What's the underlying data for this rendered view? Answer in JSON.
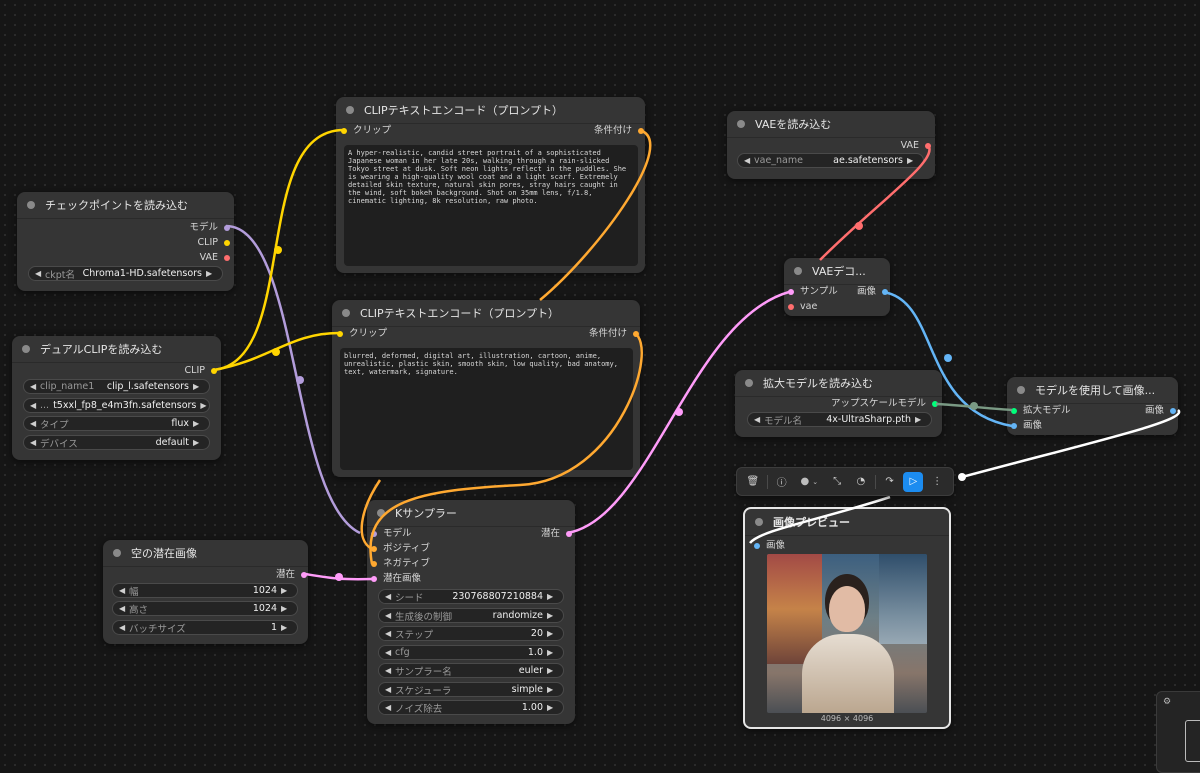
{
  "colors": {
    "model": "#b39ddb",
    "clip": "#ffd500",
    "vae": "#ff6e6e",
    "conditioning": "#ffa931",
    "latent": "#ff9cf9",
    "image": "#64b5f6",
    "upscale_model": "#00ff7b",
    "widget_bg": "#242424",
    "node_bg": "#353535",
    "run_button": "#1c8cf0"
  },
  "nodes": {
    "checkpoint": {
      "title": "チェックポイントを読み込む",
      "outputs": [
        "モデル",
        "CLIP",
        "VAE"
      ],
      "widget": {
        "label": "ckpt名",
        "value": "Chroma1-HD.safetensors"
      }
    },
    "dual_clip": {
      "title": "デュアルCLIPを読み込む",
      "output": "CLIP",
      "widgets": [
        {
          "label": "clip_name1",
          "value": "clip_l.safetensors"
        },
        {
          "label": "...",
          "value": "t5xxl_fp8_e4m3fn.safetensors"
        },
        {
          "label": "タイプ",
          "value": "flux"
        },
        {
          "label": "デバイス",
          "value": "default"
        }
      ]
    },
    "clip_pos": {
      "title": "CLIPテキストエンコード（プロンプト）",
      "input": "クリップ",
      "output": "条件付け",
      "text": "A hyper-realistic, candid street portrait of a sophisticated Japanese woman in her late 20s, walking through a rain-slicked Tokyo street at dusk. Soft neon lights reflect in the puddles. She is wearing a high-quality wool coat and a light scarf. Extremely detailed skin texture, natural skin pores, stray hairs caught in the wind, soft bokeh background. Shot on 35mm lens, f/1.8, cinematic lighting, 8k resolution, raw photo."
    },
    "clip_neg": {
      "title": "CLIPテキストエンコード（プロンプト）",
      "input": "クリップ",
      "output": "条件付け",
      "text": "blurred, deformed, digital art, illustration, cartoon, anime, unrealistic, plastic skin, smooth skin, low quality, bad anatomy, text, watermark, signature."
    },
    "empty_latent": {
      "title": "空の潜在画像",
      "output": "潜在",
      "widgets": [
        {
          "label": "幅",
          "value": "1024"
        },
        {
          "label": "高さ",
          "value": "1024"
        },
        {
          "label": "バッチサイズ",
          "value": "1"
        }
      ]
    },
    "ksampler": {
      "title": "Kサンプラー",
      "inputs": [
        "モデル",
        "ポジティブ",
        "ネガティブ",
        "潜在画像"
      ],
      "output": "潜在",
      "widgets": [
        {
          "label": "シード",
          "value": "230768807210884"
        },
        {
          "label": "生成後の制御",
          "value": "randomize"
        },
        {
          "label": "ステップ",
          "value": "20"
        },
        {
          "label": "cfg",
          "value": "1.0"
        },
        {
          "label": "サンプラー名",
          "value": "euler"
        },
        {
          "label": "スケジューラ",
          "value": "simple"
        },
        {
          "label": "ノイズ除去",
          "value": "1.00"
        }
      ]
    },
    "vae_load": {
      "title": "VAEを読み込む",
      "output": "VAE",
      "widget": {
        "label": "vae_name",
        "value": "ae.safetensors"
      }
    },
    "vae_decode": {
      "title": "VAEデコ...",
      "inputs": [
        "サンプル",
        "vae"
      ],
      "output": "画像"
    },
    "upscale_load": {
      "title": "拡大モデルを読み込む",
      "output": "アップスケールモデル",
      "widget": {
        "label": "モデル名",
        "value": "4x-UltraSharp.pth"
      }
    },
    "upscale_apply": {
      "title": "モデルを使用して画像...",
      "inputs": [
        "拡大モデル",
        "画像"
      ],
      "output": "画像"
    },
    "preview": {
      "title": "画像プレビュー",
      "input": "画像",
      "dimensions": "4096 × 4096"
    }
  },
  "toolbar": {
    "icons": [
      "trash-icon",
      "info-icon",
      "color-icon",
      "collapse-icon",
      "bypass-icon",
      "redo-icon",
      "run-icon",
      "more-icon"
    ],
    "glyphs": [
      "🗑",
      "ⓘ",
      "●",
      "⤡",
      "◔",
      "↷",
      "▷",
      "⋮"
    ]
  }
}
